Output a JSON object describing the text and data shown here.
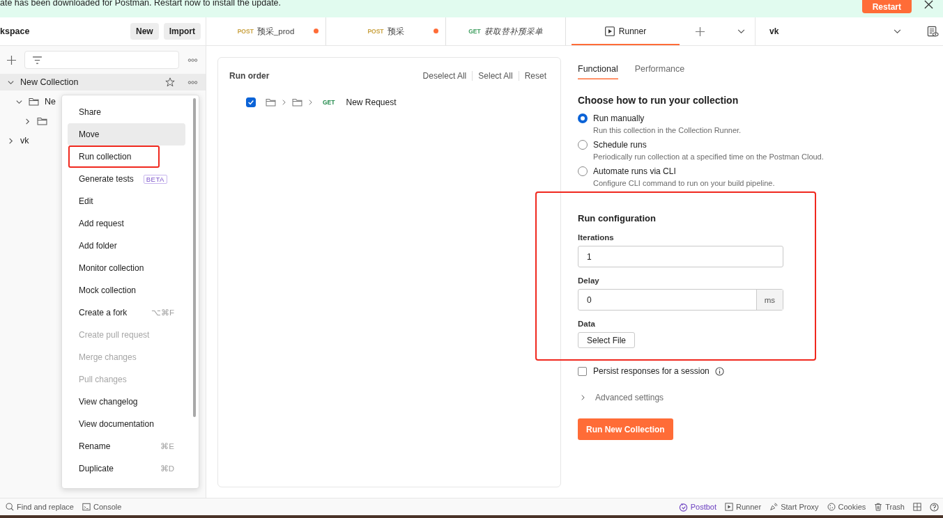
{
  "banner": {
    "message": "ate has been downloaded for Postman. Restart now to install the update.",
    "action": "Restart"
  },
  "sidebar": {
    "title": "kspace",
    "buttons": [
      "New",
      "Import"
    ],
    "tree": [
      {
        "name": "New Collection",
        "expanded": true,
        "selected": true,
        "children": [
          {
            "name": "Ne",
            "expanded": true,
            "selected": false,
            "children": [
              {
                "expanded": false,
                "selected": false
              }
            ]
          }
        ]
      },
      {
        "name": "vk",
        "expanded": false,
        "selected": false
      }
    ]
  },
  "context_menu": {
    "items": [
      {
        "label": "Share",
        "selected": false,
        "disabled": false,
        "highlighted": false
      },
      {
        "label": "Move",
        "selected": true,
        "disabled": false,
        "highlighted": false
      },
      {
        "label": "Run collection",
        "selected": false,
        "disabled": false,
        "highlighted": true
      },
      {
        "label": "Generate tests",
        "badge": "BETA",
        "selected": false,
        "disabled": false,
        "highlighted": false
      },
      {
        "label": "Edit",
        "selected": false,
        "disabled": false,
        "highlighted": false
      },
      {
        "label": "Add request",
        "selected": false,
        "disabled": false,
        "highlighted": false
      },
      {
        "label": "Add folder",
        "selected": false,
        "disabled": false,
        "highlighted": false
      },
      {
        "label": "Monitor collection",
        "selected": false,
        "disabled": false,
        "highlighted": false
      },
      {
        "label": "Mock collection",
        "selected": false,
        "disabled": false,
        "highlighted": false
      },
      {
        "label": "Create a fork",
        "shortcut": "⌥⌘F",
        "selected": false,
        "disabled": false,
        "highlighted": false
      },
      {
        "label": "Create pull request",
        "selected": false,
        "disabled": true,
        "highlighted": false
      },
      {
        "label": "Merge changes",
        "selected": false,
        "disabled": true,
        "highlighted": false
      },
      {
        "label": "Pull changes",
        "selected": false,
        "disabled": true,
        "highlighted": false
      },
      {
        "label": "View changelog",
        "selected": false,
        "disabled": false,
        "highlighted": false
      },
      {
        "label": "View documentation",
        "selected": false,
        "disabled": false,
        "highlighted": false
      },
      {
        "label": "Rename",
        "shortcut": "⌘E",
        "selected": false,
        "disabled": false,
        "highlighted": false
      },
      {
        "label": "Duplicate",
        "shortcut": "⌘D",
        "selected": false,
        "disabled": false,
        "highlighted": false
      }
    ]
  },
  "tabs": [
    {
      "kind": "request",
      "method": "POST",
      "color": "#c9a13f",
      "name": "预采_prod",
      "unsaved": true,
      "preview": false,
      "selected": false
    },
    {
      "kind": "request",
      "method": "POST",
      "color": "#c9a13f",
      "name": "预采",
      "unsaved": true,
      "preview": false,
      "selected": false
    },
    {
      "kind": "request",
      "method": "GET",
      "color": "#3f9e5f",
      "name": "获取替补预采单",
      "unsaved": false,
      "preview": true,
      "selected": false
    },
    {
      "kind": "runner",
      "name": "Runner",
      "selected": true
    }
  ],
  "environment": {
    "value": "vk"
  },
  "run_order": {
    "title": "Run order",
    "actions": [
      "Deselect All",
      "Select All",
      "Reset"
    ],
    "items": [
      {
        "checked": true,
        "method": "GET",
        "name": "New Request"
      }
    ]
  },
  "mode_tabs": [
    {
      "label": "Functional",
      "selected": true
    },
    {
      "label": "Performance",
      "selected": false
    }
  ],
  "run_mode": {
    "title": "Choose how to run your collection",
    "options": [
      {
        "label": "Run manually",
        "description": "Run this collection in the Collection Runner.",
        "selected": true
      },
      {
        "label": "Schedule runs",
        "description": "Periodically run collection at a specified time on the Postman Cloud.",
        "selected": false
      },
      {
        "label": "Automate runs via CLI",
        "description": "Configure CLI command to run on your build pipeline.",
        "selected": false
      }
    ]
  },
  "run_configuration": {
    "highlighted": true,
    "title": "Run configuration",
    "fields": [
      {
        "label": "Iterations",
        "value": "1"
      },
      {
        "label": "Delay",
        "value": "0",
        "suffix": "ms"
      }
    ],
    "data": {
      "label": "Data",
      "button": "Select File"
    }
  },
  "persist": {
    "label": "Persist responses for a session",
    "checked": false
  },
  "advanced": {
    "label": "Advanced settings",
    "expanded": false
  },
  "run_button": "Run New Collection",
  "status_bar": {
    "left": [
      {
        "kind": "search",
        "label": "Find and replace"
      },
      {
        "kind": "console",
        "label": "Console"
      }
    ],
    "right": [
      {
        "kind": "postbot",
        "label": "Postbot"
      },
      {
        "kind": "runner",
        "label": "Runner"
      },
      {
        "kind": "proxy",
        "label": "Start Proxy"
      },
      {
        "kind": "cookies",
        "label": "Cookies"
      },
      {
        "kind": "trash",
        "label": "Trash"
      },
      {
        "kind": "layout"
      },
      {
        "kind": "help"
      }
    ]
  }
}
